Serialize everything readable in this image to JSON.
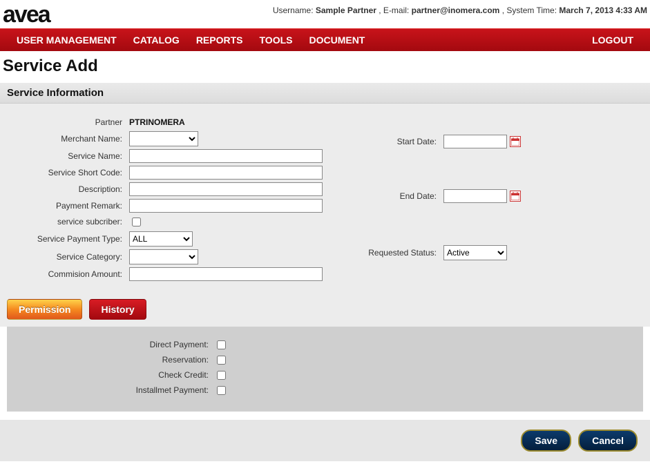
{
  "brand": "avea",
  "header": {
    "username_label": "Username: ",
    "username": "Sample Partner",
    "email_label": " , E-mail: ",
    "email": "partner@inomera.com",
    "time_label": " , System Time: ",
    "time": "March 7, 2013 4:33 AM"
  },
  "nav": {
    "items": [
      "USER MANAGEMENT",
      "CATALOG",
      "REPORTS",
      "TOOLS",
      "DOCUMENT"
    ],
    "logout": "LOGOUT"
  },
  "page_title": "Service Add",
  "section_title": "Service Information",
  "left_fields": {
    "partner_label": "Partner",
    "partner_value": "PTRINOMERA",
    "merchant_label": "Merchant Name:",
    "service_name_label": "Service Name:",
    "short_code_label": "Service Short Code:",
    "description_label": "Description:",
    "payment_remark_label": "Payment Remark:",
    "subscriber_label": "service subcriber:",
    "payment_type_label": "Service Payment Type:",
    "payment_type_value": "ALL",
    "category_label": "Service Category:",
    "commission_label": "Commision Amount:"
  },
  "right_fields": {
    "start_date_label": "Start Date:",
    "end_date_label": "End Date:",
    "status_label": "Requested Status:",
    "status_value": "Active"
  },
  "tabs": {
    "permission": "Permission",
    "history": "History"
  },
  "permissions": {
    "direct_payment": "Direct Payment:",
    "reservation": "Reservation:",
    "check_credit": "Check Credit:",
    "installment": "Installmet Payment:"
  },
  "buttons": {
    "save": "Save",
    "cancel": "Cancel"
  }
}
